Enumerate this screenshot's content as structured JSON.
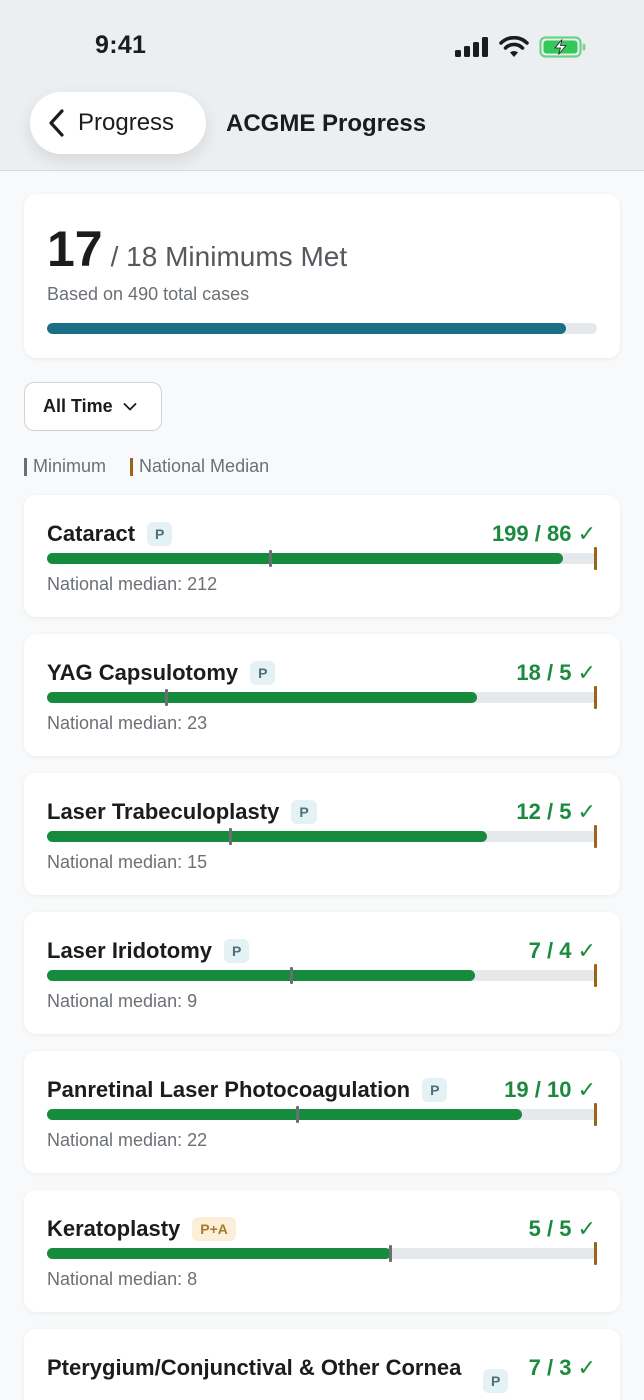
{
  "status": {
    "time": "9:41"
  },
  "nav": {
    "back_label": "Progress",
    "title": "ACGME Progress"
  },
  "summary": {
    "met": "17",
    "rest": "/ 18 Minimums Met",
    "subtitle": "Based on 490 total cases",
    "progress": 0.944
  },
  "filter": {
    "label": "All Time"
  },
  "legend": {
    "minimum": "Minimum",
    "median": "National Median"
  },
  "colors": {
    "accent": "#1a6f86",
    "success": "#168a3d",
    "minimum": "#6b6f73",
    "median": "#9a6417"
  },
  "procedures": [
    {
      "name": "Cataract",
      "badge": "P",
      "value": "199 / 86 ✓",
      "sub": "National median: 212",
      "done": 199,
      "min": 86,
      "median": 212
    },
    {
      "name": "YAG Capsulotomy",
      "badge": "P",
      "value": "18 / 5 ✓",
      "sub": "National median: 23",
      "done": 18,
      "min": 5,
      "median": 23
    },
    {
      "name": "Laser Trabeculoplasty",
      "badge": "P",
      "value": "12 / 5 ✓",
      "sub": "National median: 15",
      "done": 12,
      "min": 5,
      "median": 15
    },
    {
      "name": "Laser Iridotomy",
      "badge": "P",
      "value": "7 / 4 ✓",
      "sub": "National median: 9",
      "done": 7,
      "min": 4,
      "median": 9
    },
    {
      "name": "Panretinal Laser Photocoagulation",
      "badge": "P",
      "value": "19 / 10 ✓",
      "sub": "National median: 22",
      "done": 19,
      "min": 10,
      "median": 22
    },
    {
      "name": "Keratoplasty",
      "badge": "P+A",
      "value": "5 / 5 ✓",
      "sub": "National median: 8",
      "done": 5,
      "min": 5,
      "median": 8
    },
    {
      "name": "Pterygium/Conjunctival & Other Cornea",
      "badge": "P",
      "value": "7 / 3 ✓",
      "sub": "",
      "done": 7,
      "min": 3,
      "median": 0
    }
  ]
}
